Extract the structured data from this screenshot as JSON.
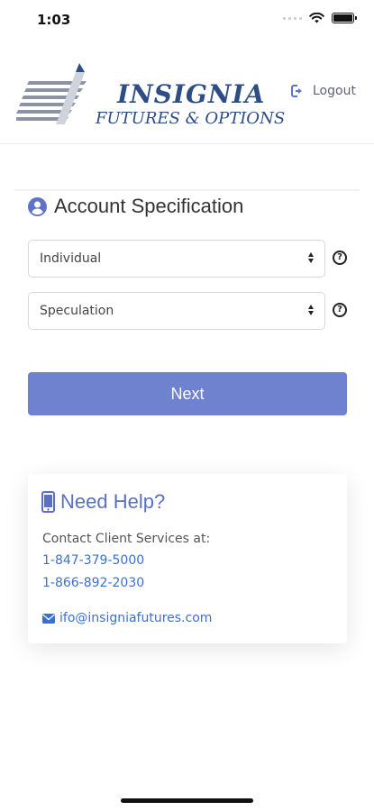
{
  "status_bar": {
    "time": "1:03",
    "icons": [
      "signal-icon",
      "wifi-icon",
      "battery-icon"
    ]
  },
  "header": {
    "logo": {
      "name": "INSIGNIA",
      "tagline": "FUTURES & OPTIONS",
      "color": "#2d4d85"
    },
    "logout": {
      "icon": "logout-icon",
      "label": "Logout"
    }
  },
  "account": {
    "title": "Account Specification",
    "title_icon": "user-circle-icon",
    "account_type": {
      "value": "Individual",
      "help_icon": "question-circle-icon"
    },
    "purpose": {
      "value": "Speculation",
      "help_icon": "question-circle-icon"
    },
    "next_label": "Next",
    "accent_color": "#6f82cf"
  },
  "help": {
    "icon": "mobile-phone-icon",
    "title": "Need Help?",
    "contact_text": "Contact Client Services at:",
    "phones": [
      "1-847-379-5000",
      "1-866-892-2030"
    ],
    "email_icon": "envelope-icon",
    "email": "ifo@insigniafutures.com",
    "link_color": "#3c6fd6"
  }
}
